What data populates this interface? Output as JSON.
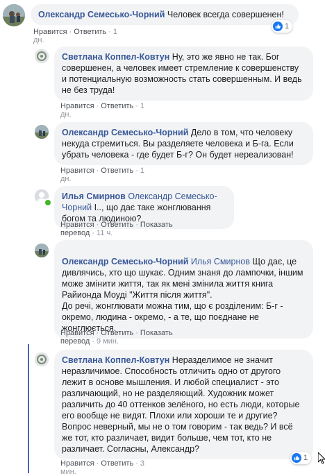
{
  "comments": [
    {
      "author": "Олександр Семесько-Чорний",
      "mention": "",
      "text": "Человек всегда совершенен!",
      "actions": {
        "like": "Нравится",
        "reply": "Ответить",
        "translate": "",
        "time": "1 дн."
      },
      "reactions": "1"
    },
    {
      "author": "Светлана Коппел-Ковтун",
      "mention": "",
      "text": "Ну, это же явно не так. Бог совершенен, а человек имеет стремление к совершенству и потенциальную возможность стать совершенным. И ведь не без труда!",
      "actions": {
        "like": "Нравится",
        "reply": "Ответить",
        "translate": "",
        "time": "1 дн."
      },
      "reactions": ""
    },
    {
      "author": "Олександр Семесько-Чорний",
      "mention": "",
      "text": "Дело в том, что человеку некуда стремиться. Вы разделяете человека и Б-га. Если убрать человека - где будет Б-г? Он будет нереализован!",
      "actions": {
        "like": "Нравится",
        "reply": "Ответить",
        "translate": "",
        "time": "1 дн."
      },
      "reactions": ""
    },
    {
      "author": "Илья Смирнов",
      "mention": "Олександр Семесько-Чорний",
      "text": "І.., що дає таке жонглювання богом та людиною?",
      "actions": {
        "like": "Нравится",
        "reply": "Ответить",
        "translate": "Показать перевод",
        "time": "11 ч."
      },
      "reactions": ""
    },
    {
      "author": "Олександр Семесько-Чорний",
      "mention": "Илья Смирнов",
      "text": "Що дає, це дивлячись, хто що шукає. Одним знаня до лампочки, іншим може змінити життя, так як мені змінила життя книга Райионда Моуді \"Життя після життя\".\nДо речі, жонглювати можна тим, що є розділеним: Б-г - окремо, людина - окремо, - а те, що поєднане не жонглюється.",
      "actions": {
        "like": "Нравится",
        "reply": "Ответить",
        "translate": "Показать перевод",
        "time": "9 мин."
      },
      "reactions": ""
    },
    {
      "author": "Светлана Коппел-Ковтун",
      "mention": "",
      "text": "Неразделимое не значит неразличимое. Способность отличить одно от другого лежит в основе мышления. И любой специалист - это различающий, но не разделяющий. Художник может различить до 40 оттенков зелёного, но есть люди, которые его вообще не видят. Плохи или хороши те и другие? Вопрос неверный, мы не о том говорим - так ведь? И всё же тот, кто различает, видит больше, чем тот, кто не различает. Согласны, Александр?",
      "actions": {
        "like": "Нравится",
        "reply": "Ответить",
        "translate": "",
        "time": "3 мин."
      },
      "reactions": "1"
    }
  ],
  "colors": {
    "author": "#385898",
    "bubble": "#f2f3f5",
    "like": "#1877f2",
    "thread": "#4267b2",
    "online": "#42b72a"
  }
}
